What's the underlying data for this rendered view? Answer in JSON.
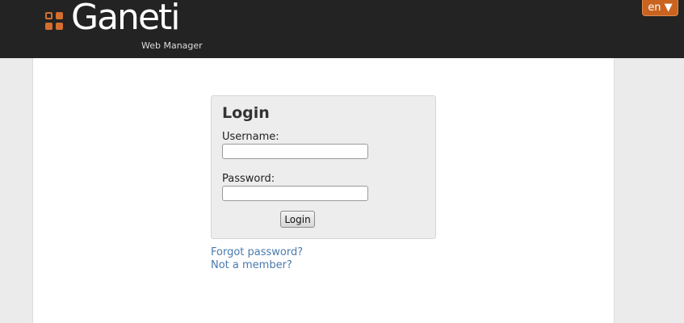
{
  "header": {
    "logo_text": "Ganeti",
    "logo_subtitle": "Web Manager",
    "language_selector": "en ▼"
  },
  "login": {
    "title": "Login",
    "username_label": "Username:",
    "username_value": "",
    "password_label": "Password:",
    "password_value": "",
    "submit_label": "Login"
  },
  "links": {
    "forgot_password": "Forgot password?",
    "not_member": "Not a member?"
  },
  "colors": {
    "header_bg": "#232323",
    "accent": "#c9631f",
    "link": "#4a7aad"
  },
  "icons": {
    "logo_mark": "ganeti-grid-logo-icon",
    "dropdown": "triangle-down-icon"
  }
}
